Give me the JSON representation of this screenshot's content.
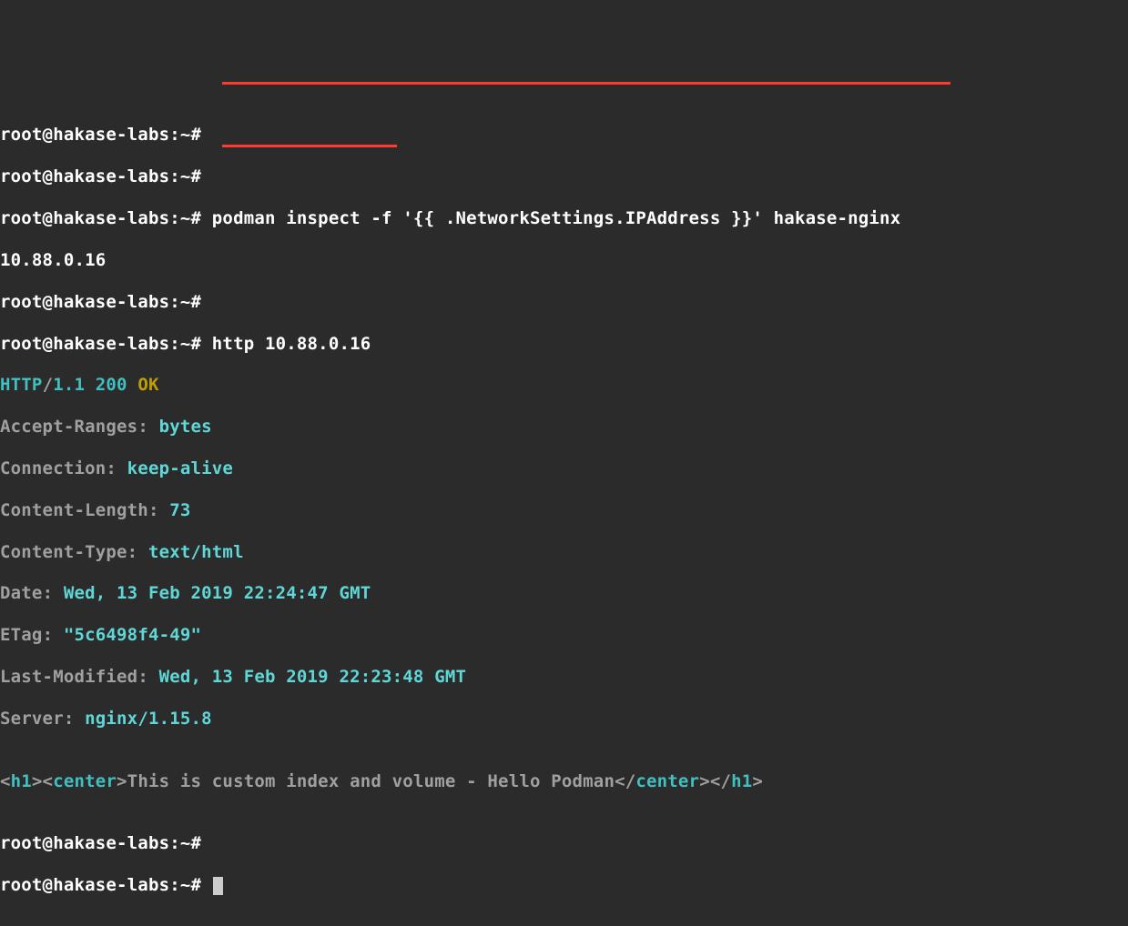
{
  "lines": {
    "l1_user": "root@hakase-labs",
    "l1_sep": ":",
    "l1_path": "~",
    "l1_hash": "#",
    "l2_user": "root@hakase-labs",
    "l2_sep": ":",
    "l2_path": "~",
    "l2_hash": "#",
    "l3_user": "root@hakase-labs",
    "l3_sep": ":",
    "l3_path": "~",
    "l3_hash": "#",
    "l3_cmd": " podman inspect -f '{{ .NetworkSettings.IPAddress }}' hakase-nginx",
    "l4_ip": "10.88.0.16",
    "l5_user": "root@hakase-labs",
    "l5_sep": ":",
    "l5_path": "~",
    "l5_hash": "#",
    "l6_user": "root@hakase-labs",
    "l6_sep": ":",
    "l6_path": "~",
    "l6_hash": "#",
    "l6_cmd": " http 10.88.0.16",
    "resp_proto": "HTTP",
    "resp_slash": "/",
    "resp_ver": "1.1",
    "resp_sp1": " ",
    "resp_code": "200",
    "resp_sp2": " ",
    "resp_ok": "OK",
    "h_accept_k": "Accept-Ranges",
    "h_accept_c": ": ",
    "h_accept_v": "bytes",
    "h_conn_k": "Connection",
    "h_conn_c": ": ",
    "h_conn_v": "keep-alive",
    "h_clen_k": "Content-Length",
    "h_clen_c": ": ",
    "h_clen_v": "73",
    "h_ctype_k": "Content-Type",
    "h_ctype_c": ": ",
    "h_ctype_v": "text/html",
    "h_date_k": "Date",
    "h_date_c": ": ",
    "h_date_v": "Wed, 13 Feb 2019 22:24:47 GMT",
    "h_etag_k": "ETag",
    "h_etag_c": ": ",
    "h_etag_v": "\"5c6498f4-49\"",
    "h_lmod_k": "Last-Modified",
    "h_lmod_c": ": ",
    "h_lmod_v": "Wed, 13 Feb 2019 22:23:48 GMT",
    "h_serv_k": "Server",
    "h_serv_c": ": ",
    "h_serv_v": "nginx/1.15.8",
    "blank": "",
    "body_1": "<",
    "body_h1o": "h1",
    "body_2": "><",
    "body_co": "center",
    "body_3": ">This is custom index and volume - Hello Podman</",
    "body_cc": "center",
    "body_4": "></",
    "body_h1c": "h1",
    "body_5": ">",
    "l19_user": "root@hakase-labs",
    "l19_sep": ":",
    "l19_path": "~",
    "l19_hash": "#",
    "l20_user": "root@hakase-labs",
    "l20_sep": ":",
    "l20_path": "~",
    "l20_hash": "#"
  }
}
